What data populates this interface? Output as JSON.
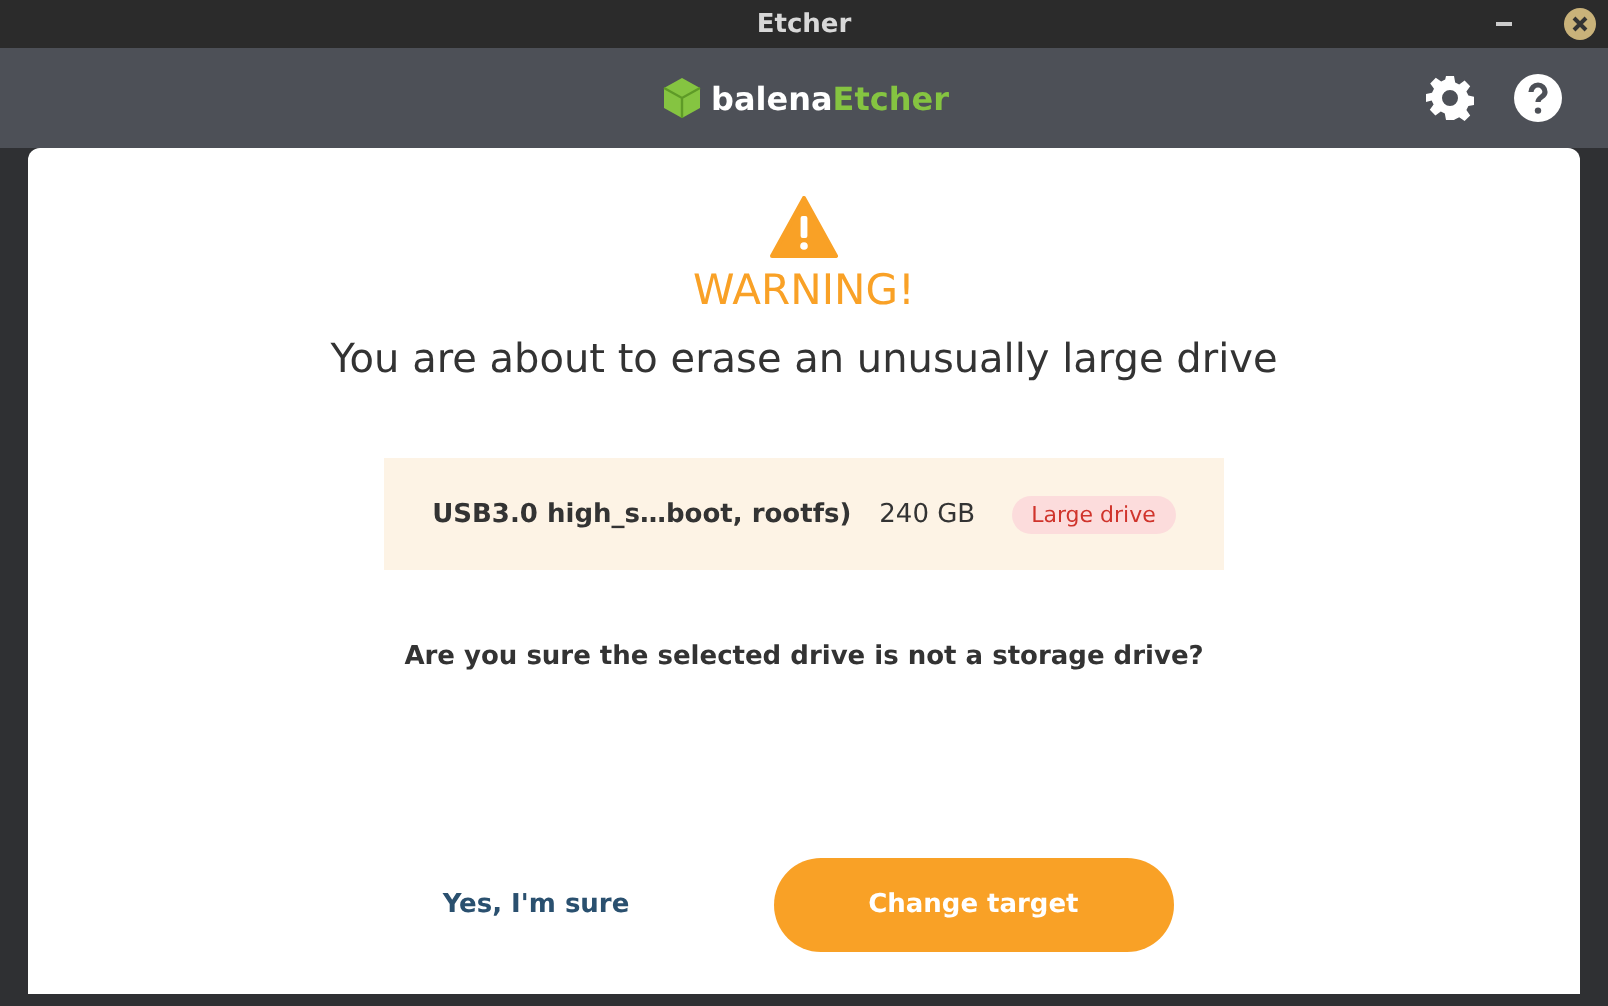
{
  "window": {
    "title": "Etcher"
  },
  "header": {
    "logo_brand": "balena",
    "logo_product": "Etcher"
  },
  "dialog": {
    "warning_label": "WARNING!",
    "heading": "You are about to erase an unusually large drive",
    "drives": [
      {
        "name": "USB3.0 high_s…boot, rootfs)",
        "size": "240 GB",
        "badge": "Large drive"
      }
    ],
    "question": "Are you sure the selected drive is not a storage drive?",
    "buttons": [
      {
        "label": "Yes, I'm sure",
        "kind": "link"
      },
      {
        "label": "Change target",
        "kind": "primary"
      }
    ]
  }
}
